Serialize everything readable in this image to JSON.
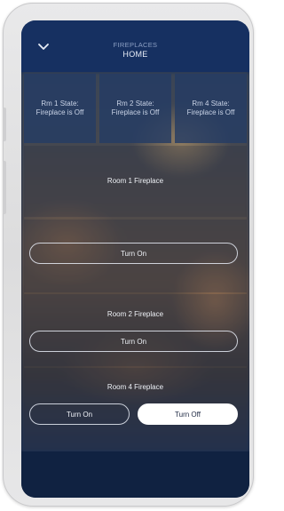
{
  "header": {
    "section": "FIREPLACES",
    "title": "HOME"
  },
  "status_tiles": [
    {
      "label": "Rm 1 State: Fireplace is Off"
    },
    {
      "label": "Rm 2 State: Fireplace is Off"
    },
    {
      "label": "Rm 4 State: Fireplace is Off"
    }
  ],
  "rooms": {
    "room1": {
      "label": "Room 1 Fireplace",
      "on_label": "Turn On"
    },
    "room2": {
      "label": "Room 2 Fireplace",
      "on_label": "Turn On"
    },
    "room4": {
      "label": "Room 4 Fireplace",
      "on_label": "Turn On",
      "off_label": "Turn Off"
    }
  },
  "icons": {
    "back": "chevron-down-icon"
  }
}
